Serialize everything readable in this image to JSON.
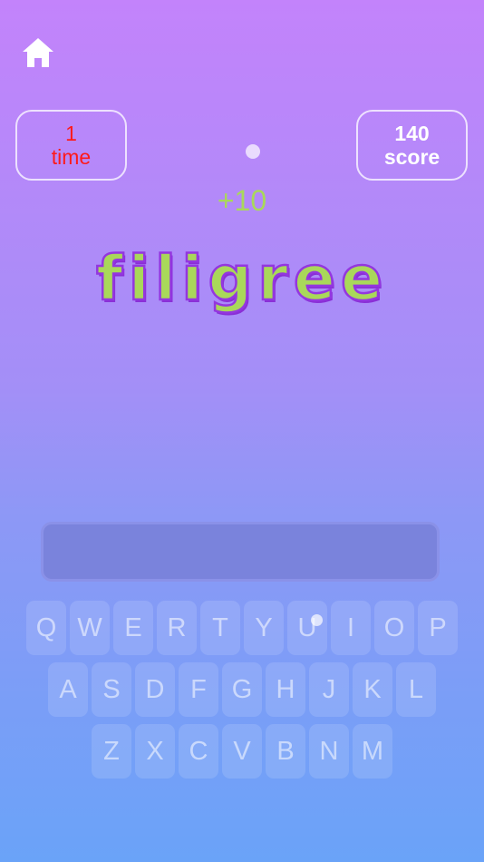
{
  "header": {
    "home_icon": "home-icon"
  },
  "stats": {
    "time_value": "1",
    "time_label": "time",
    "score_value": "140",
    "score_label": "score"
  },
  "bonus": "+10",
  "word": "filigree",
  "colors": {
    "word_fill": "#a9d85a",
    "word_outline": "#9436e0",
    "time_text": "#ff1a1a",
    "bg_top": "#c383fb",
    "bg_bottom": "#6aa3f8"
  },
  "keyboard": {
    "rows": [
      [
        "Q",
        "W",
        "E",
        "R",
        "T",
        "Y",
        "U",
        "I",
        "O",
        "P"
      ],
      [
        "A",
        "S",
        "D",
        "F",
        "G",
        "H",
        "J",
        "K",
        "L"
      ],
      [
        "Z",
        "X",
        "C",
        "V",
        "B",
        "N",
        "M"
      ]
    ]
  }
}
